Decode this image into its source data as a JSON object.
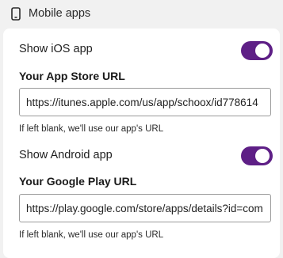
{
  "section": {
    "title": "Mobile apps",
    "icon": "mobile-phone-icon"
  },
  "ios": {
    "toggle_label": "Show iOS app",
    "enabled": true,
    "field_label": "Your App Store URL",
    "value": "https://itunes.apple.com/us/app/schoox/id778614",
    "hint": "If left blank, we'll use our app's URL"
  },
  "android": {
    "toggle_label": "Show Android app",
    "enabled": true,
    "field_label": "Your Google Play URL",
    "value": "https://play.google.com/store/apps/details?id=com",
    "hint": "If left blank, we'll use our app's URL"
  },
  "colors": {
    "toggle_on": "#5e1f86",
    "background": "#f1f1f1",
    "card": "#ffffff"
  }
}
